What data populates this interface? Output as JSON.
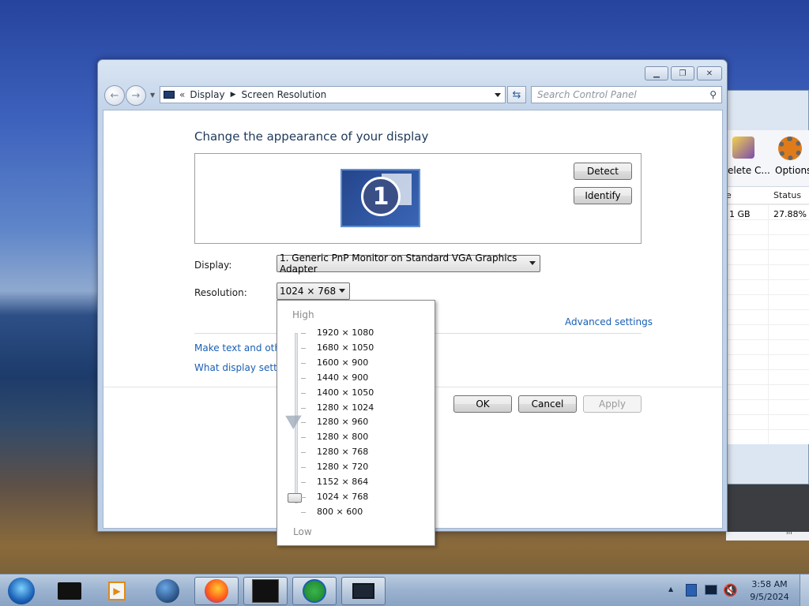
{
  "window": {
    "caption_buttons": [
      "minimize",
      "maximize",
      "close"
    ],
    "breadcrumb": [
      "Display",
      "Screen Resolution"
    ],
    "search_placeholder": "Search Control Panel",
    "heading": "Change the appearance of your display",
    "monitor_number": "1",
    "detect_label": "Detect",
    "identify_label": "Identify",
    "display_label": "Display:",
    "display_value": "1. Generic PnP Monitor on Standard VGA Graphics Adapter",
    "resolution_label": "Resolution:",
    "resolution_value": "1024 × 768",
    "advanced_link": "Advanced settings",
    "link_text_size": "Make text and other",
    "link_display_settings": "What display setting",
    "ok_label": "OK",
    "cancel_label": "Cancel",
    "apply_label": "Apply"
  },
  "dropdown": {
    "high_label": "High",
    "low_label": "Low",
    "resolutions": [
      "1920 × 1080",
      "1680 × 1050",
      "1600 × 900",
      "1440 × 900",
      "1400 × 1050",
      "1280 × 1024",
      "1280 × 960",
      "1280 × 800",
      "1280 × 768",
      "1280 × 720",
      "1152 × 864",
      "1024 × 768",
      "800 × 600"
    ],
    "selected": "1024 × 768"
  },
  "background_window": {
    "toolbar": [
      "elete C...",
      "Options"
    ],
    "columns": [
      "e",
      "Status"
    ],
    "row": [
      "1 GB",
      "27.88%"
    ],
    "scroll_marker": "III"
  },
  "taskbar": {
    "apps": [
      "start-orb",
      "black-box-app",
      "media-player",
      "globe-app",
      "firefox",
      "task-manager-app",
      "download-manager",
      "display-app"
    ],
    "tray_up": "▲",
    "time": "3:58 AM",
    "date": "9/5/2024"
  },
  "colors": {
    "link": "#1a5fb4",
    "heading": "#1e395b",
    "accent": "#3b5da8"
  }
}
